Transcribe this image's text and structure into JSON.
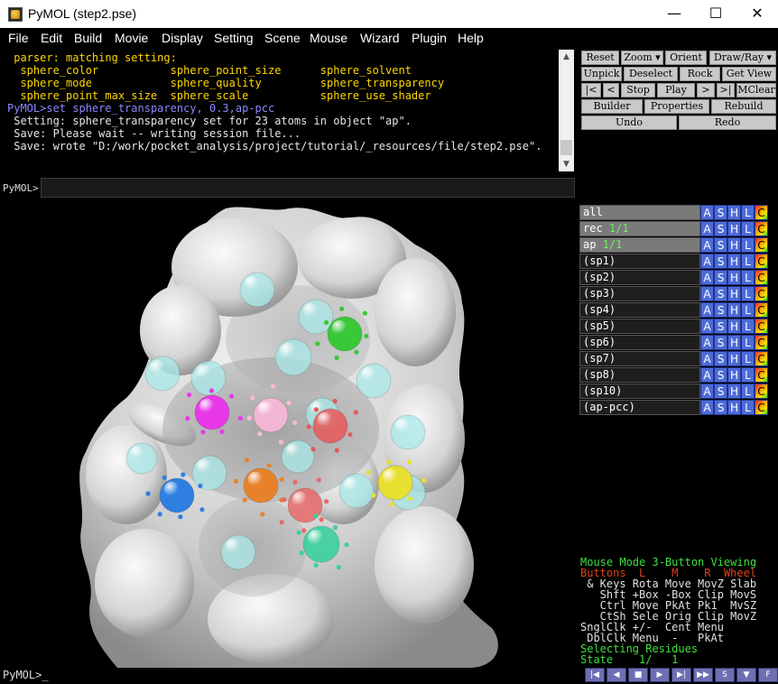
{
  "window": {
    "title": "PyMOL (step2.pse)",
    "minimize": "—",
    "maximize": "☐",
    "close": "✕"
  },
  "menu": [
    "File",
    "Edit",
    "Build",
    "Movie",
    "Display",
    "Setting",
    "Scene",
    "Mouse",
    "Wizard",
    "Plugin",
    "Help"
  ],
  "console": {
    "lines": [
      {
        "text": " parser: matching setting:",
        "color": "yellow"
      },
      {
        "text": "  sphere_color           sphere_point_size      sphere_solvent",
        "color": "yellow"
      },
      {
        "text": "  sphere_mode            sphere_quality         sphere_transparency",
        "color": "yellow"
      },
      {
        "text": "  sphere_point_max_size  sphere_scale           sphere_use_shader",
        "color": "yellow"
      },
      {
        "text": "PyMOL>set sphere_transparency, 0.3,ap-pcc",
        "color": "blue"
      },
      {
        "text": " Setting: sphere_transparency set for 23 atoms in object \"ap\".",
        "color": "white"
      },
      {
        "text": " Save: Please wait -- writing session file...",
        "color": "white"
      },
      {
        "text": " Save: wrote \"D:/work/pocket_analysis/project/tutorial/_resources/file/step2.pse\".",
        "color": "white"
      }
    ],
    "prompt": "PyMOL>",
    "input_value": ""
  },
  "buttons": {
    "row1": [
      "Reset",
      "Zoom",
      "Orient",
      "Draw/Ray"
    ],
    "row2": [
      "Unpick",
      "Deselect",
      "Rock",
      "Get View"
    ],
    "row3": [
      "|<",
      "<",
      "Stop",
      "Play",
      ">",
      ">|",
      "MClear"
    ],
    "row4": [
      "Builder",
      "Properties",
      "Rebuild"
    ],
    "row5": [
      "Undo",
      "Redo"
    ]
  },
  "objects": [
    {
      "name": "all",
      "count": "",
      "enabled": true
    },
    {
      "name": "rec",
      "count": "1/1",
      "enabled": true
    },
    {
      "name": "ap",
      "count": "1/1",
      "enabled": true
    },
    {
      "name": "(sp1)",
      "count": "",
      "enabled": false
    },
    {
      "name": "(sp2)",
      "count": "",
      "enabled": false
    },
    {
      "name": "(sp3)",
      "count": "",
      "enabled": false
    },
    {
      "name": "(sp4)",
      "count": "",
      "enabled": false
    },
    {
      "name": "(sp5)",
      "count": "",
      "enabled": false
    },
    {
      "name": "(sp6)",
      "count": "",
      "enabled": false
    },
    {
      "name": "(sp7)",
      "count": "",
      "enabled": false
    },
    {
      "name": "(sp8)",
      "count": "",
      "enabled": false
    },
    {
      "name": "(sp10)",
      "count": "",
      "enabled": false
    },
    {
      "name": "(ap-pcc)",
      "count": "",
      "enabled": false
    }
  ],
  "object_actions": [
    "A",
    "S",
    "H",
    "L",
    "C"
  ],
  "mouse": {
    "header": "Mouse Mode 3-Button Viewing",
    "row_buttons": "Buttons  L    M    R  Wheel",
    "row_keys": " & Keys Rota Move MovZ Slab",
    "row_shft": "   Shft +Box -Box Clip MovS",
    "row_ctrl": "   Ctrl Move PkAt Pk1  MvSZ",
    "row_ctsh": "   CtSh Sele Orig Clip MovZ",
    "row_sngl": "SnglClk +/-  Cent Menu",
    "row_dbl": " DblClk Menu  -   PkAt",
    "selecting": "Selecting Residues",
    "state": "State    1/   1"
  },
  "vcr": [
    "|◀",
    "◀",
    "■",
    "▶",
    "▶|",
    "▶▶",
    "S",
    "▼",
    "F"
  ],
  "bottom_prompt": "PyMOL>_",
  "spheres": [
    {
      "color": "#a8e8e8",
      "alpha": 0.75
    },
    {
      "color": "#38c838",
      "alpha": 1.0
    },
    {
      "color": "#e838e8",
      "alpha": 1.0
    },
    {
      "color": "#f8b8d8",
      "alpha": 0.9
    },
    {
      "color": "#e85858",
      "alpha": 0.85
    },
    {
      "color": "#2f7fe0",
      "alpha": 1.0
    },
    {
      "color": "#e8822a",
      "alpha": 1.0
    },
    {
      "color": "#e86868",
      "alpha": 0.85
    },
    {
      "color": "#e8e030",
      "alpha": 1.0
    },
    {
      "color": "#3ad0a0",
      "alpha": 0.9
    }
  ]
}
